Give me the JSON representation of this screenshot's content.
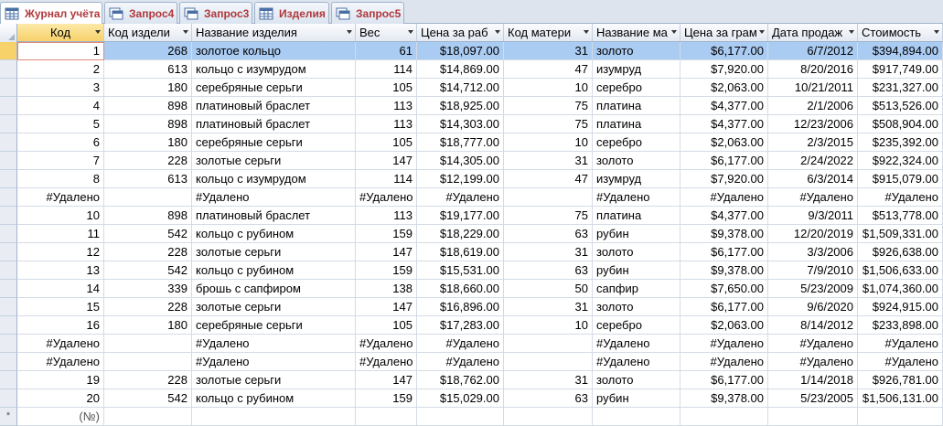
{
  "tabs": [
    {
      "label": "Журнал учёта",
      "icon": "table-icon",
      "active": true
    },
    {
      "label": "Запрос4",
      "icon": "query-icon",
      "active": false
    },
    {
      "label": "Запрос3",
      "icon": "query-icon",
      "active": false
    },
    {
      "label": "Изделия",
      "icon": "table-icon",
      "active": false
    },
    {
      "label": "Запрос5",
      "icon": "query-icon",
      "active": false
    }
  ],
  "columns": [
    "Код",
    "Код издели",
    "Название изделия",
    "Вес",
    "Цена за раб",
    "Код матери",
    "Название ма",
    "Цена за грам",
    "Дата продаж",
    "Стоимость"
  ],
  "rows": [
    [
      "1",
      "268",
      "золотое кольцо",
      "61",
      "$18,097.00",
      "31",
      "золото",
      "$6,177.00",
      "6/7/2012",
      "$394,894.00"
    ],
    [
      "2",
      "613",
      "кольцо с изумрудом",
      "114",
      "$14,869.00",
      "47",
      "изумруд",
      "$7,920.00",
      "8/20/2016",
      "$917,749.00"
    ],
    [
      "3",
      "180",
      "серебряные серьги",
      "105",
      "$14,712.00",
      "10",
      "серебро",
      "$2,063.00",
      "10/21/2011",
      "$231,327.00"
    ],
    [
      "4",
      "898",
      "платиновый браслет",
      "113",
      "$18,925.00",
      "75",
      "платина",
      "$4,377.00",
      "2/1/2006",
      "$513,526.00"
    ],
    [
      "5",
      "898",
      "платиновый браслет",
      "113",
      "$14,303.00",
      "75",
      "платина",
      "$4,377.00",
      "12/23/2006",
      "$508,904.00"
    ],
    [
      "6",
      "180",
      "серебряные серьги",
      "105",
      "$18,777.00",
      "10",
      "серебро",
      "$2,063.00",
      "2/3/2015",
      "$235,392.00"
    ],
    [
      "7",
      "228",
      "золотые серьги",
      "147",
      "$14,305.00",
      "31",
      "золото",
      "$6,177.00",
      "2/24/2022",
      "$922,324.00"
    ],
    [
      "8",
      "613",
      "кольцо с изумрудом",
      "114",
      "$12,199.00",
      "47",
      "изумруд",
      "$7,920.00",
      "6/3/2014",
      "$915,079.00"
    ],
    [
      "#Удалено",
      "",
      "#Удалено",
      "#Удалено",
      "#Удалено",
      "",
      "#Удалено",
      "#Удалено",
      "#Удалено",
      "#Удалено"
    ],
    [
      "10",
      "898",
      "платиновый браслет",
      "113",
      "$19,177.00",
      "75",
      "платина",
      "$4,377.00",
      "9/3/2011",
      "$513,778.00"
    ],
    [
      "11",
      "542",
      "кольцо с рубином",
      "159",
      "$18,229.00",
      "63",
      "рубин",
      "$9,378.00",
      "12/20/2019",
      "$1,509,331.00"
    ],
    [
      "12",
      "228",
      "золотые серьги",
      "147",
      "$18,619.00",
      "31",
      "золото",
      "$6,177.00",
      "3/3/2006",
      "$926,638.00"
    ],
    [
      "13",
      "542",
      "кольцо с рубином",
      "159",
      "$15,531.00",
      "63",
      "рубин",
      "$9,378.00",
      "7/9/2010",
      "$1,506,633.00"
    ],
    [
      "14",
      "339",
      "брошь с сапфиром",
      "138",
      "$18,660.00",
      "50",
      "сапфир",
      "$7,650.00",
      "5/23/2009",
      "$1,074,360.00"
    ],
    [
      "15",
      "228",
      "золотые серьги",
      "147",
      "$16,896.00",
      "31",
      "золото",
      "$6,177.00",
      "9/6/2020",
      "$924,915.00"
    ],
    [
      "16",
      "180",
      "серебряные серьги",
      "105",
      "$17,283.00",
      "10",
      "серебро",
      "$2,063.00",
      "8/14/2012",
      "$233,898.00"
    ],
    [
      "#Удалено",
      "",
      "#Удалено",
      "#Удалено",
      "#Удалено",
      "",
      "#Удалено",
      "#Удалено",
      "#Удалено",
      "#Удалено"
    ],
    [
      "#Удалено",
      "",
      "#Удалено",
      "#Удалено",
      "#Удалено",
      "",
      "#Удалено",
      "#Удалено",
      "#Удалено",
      "#Удалено"
    ],
    [
      "19",
      "228",
      "золотые серьги",
      "147",
      "$18,762.00",
      "31",
      "золото",
      "$6,177.00",
      "1/14/2018",
      "$926,781.00"
    ],
    [
      "20",
      "542",
      "кольцо с рубином",
      "159",
      "$15,029.00",
      "63",
      "рубин",
      "$9,378.00",
      "5/23/2005",
      "$1,506,131.00"
    ]
  ],
  "new_row": {
    "marker": "*",
    "placeholder": "(№)"
  },
  "colors": {
    "tab_text": "#b0373b",
    "selection": "#aacbf2",
    "current_header": "#f7d26a"
  }
}
